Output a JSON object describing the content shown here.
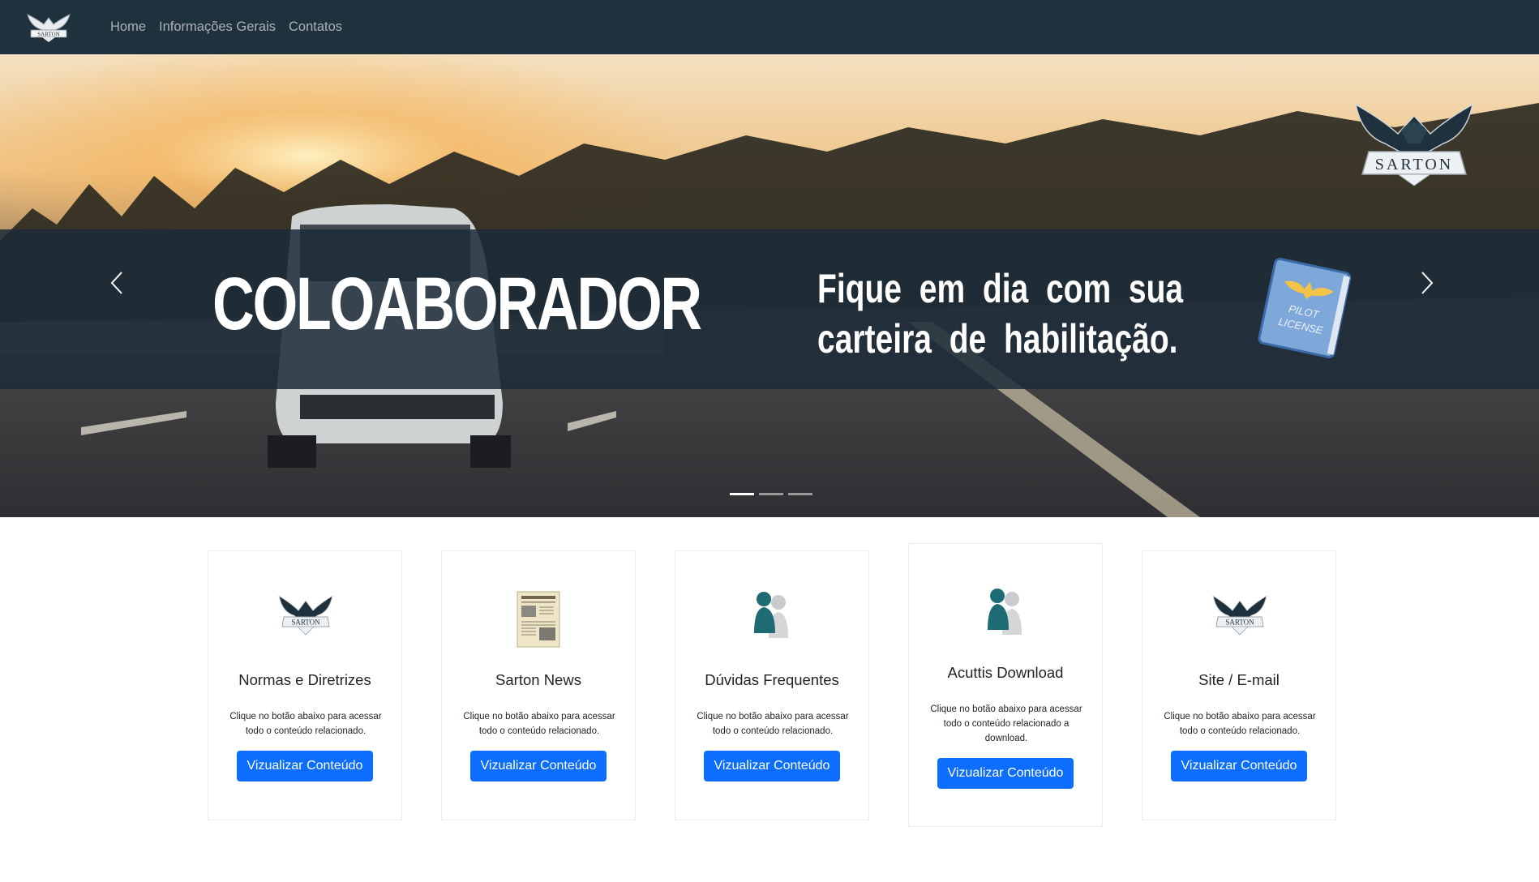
{
  "nav": {
    "links": [
      "Home",
      "Informações Gerais",
      "Contatos"
    ]
  },
  "brand": {
    "logo_text": "SARTON",
    "navy": "#1f313d",
    "primary_button": "#0d6efd"
  },
  "hero": {
    "title": "COLOABORADOR",
    "subtitle_line1": "Fique em dia com sua",
    "subtitle_line2": "carteira de habilitação.",
    "book_text_line1": "PILOT",
    "book_text_line2": "LICENSE",
    "slides": 3,
    "active_slide": 1
  },
  "cards": [
    {
      "icon": "sarton-eagle-icon",
      "title": "Normas e Diretrizes",
      "text_line1": "Clique no botão abaixo para acessar",
      "text_line2": "todo o conteúdo relacionado.",
      "text_line3": "",
      "button": "Vizualizar Conteúdo"
    },
    {
      "icon": "newspaper-icon",
      "title": "Sarton News",
      "text_line1": "Clique no botão abaixo para acessar",
      "text_line2": "todo o conteúdo relacionado.",
      "text_line3": "",
      "button": "Vizualizar Conteúdo"
    },
    {
      "icon": "people-icon",
      "title": "Dúvidas Frequentes",
      "text_line1": "Clique no botão abaixo para acessar",
      "text_line2": "todo o conteúdo relacionado.",
      "text_line3": "",
      "button": "Vizualizar Conteúdo"
    },
    {
      "icon": "people-icon",
      "title": "Acuttis Download",
      "text_line1": "Clique no botão abaixo para acessar",
      "text_line2": "todo o conteúdo relacionado a",
      "text_line3": "download.",
      "button": "Vizualizar Conteúdo"
    },
    {
      "icon": "sarton-eagle-icon",
      "title": "Site / E-mail",
      "text_line1": "Clique no botão abaixo para acessar",
      "text_line2": "todo o conteúdo relacionado.",
      "text_line3": "",
      "button": "Vizualizar Conteúdo"
    }
  ]
}
